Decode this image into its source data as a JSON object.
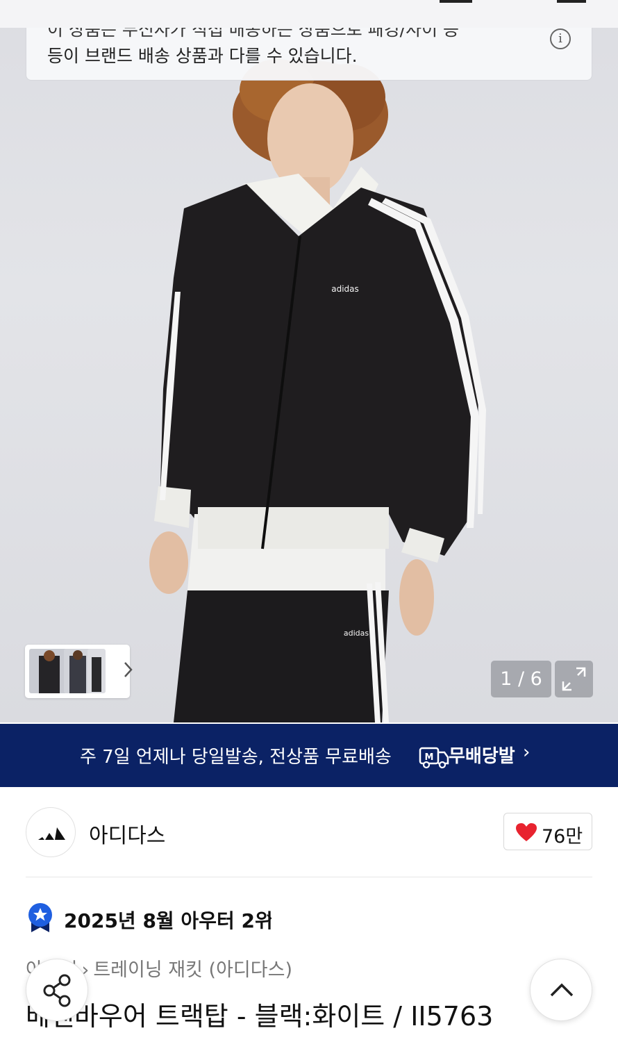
{
  "notice": {
    "line1": "이 상품은 무신사가 직접 배송하는 상품으로 패킹/사이 등",
    "line2": "등이 브랜드 배송 상품과 다를 수 있습니다.",
    "icon": "info-icon"
  },
  "gallery": {
    "counter": "1 / 6",
    "current": 1,
    "total": 6,
    "expand_icon": "expand-icon",
    "thumb_more_icon": "chevron-right-icon",
    "product_logo_text": "adidas"
  },
  "delivery_banner": {
    "text": "주 7일 언제나 당일발송, 전상품 무료배송",
    "brand": "무배당발",
    "logo_text": "M",
    "chevron": "›",
    "background": "#0b2265"
  },
  "brand": {
    "name": "아디다스",
    "logo": "adidas-logo"
  },
  "like": {
    "count": "76만",
    "heart_color": "#e8232f"
  },
  "ranking": {
    "text": "2025년 8월 아우터 2위",
    "chevron": "›",
    "badge_color": "#1f5fe0"
  },
  "breadcrumb": {
    "parent": "아우터",
    "separator": "›",
    "current": "트레이닝 재킷 (아디다스)"
  },
  "product": {
    "title": "베켄바우어 트랙탑 - 블랙:화이트 / II5763"
  }
}
